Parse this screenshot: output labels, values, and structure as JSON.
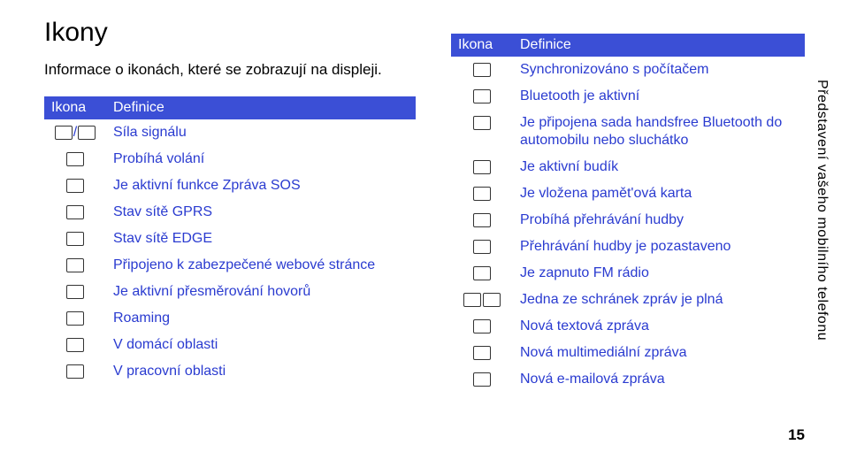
{
  "page": {
    "title": "Ikony",
    "subtitle": "Informace o ikonách, které se zobrazují na displeji.",
    "side_tab": "Představení vašeho mobilního telefonu",
    "page_number": "15"
  },
  "table_headers": {
    "icon": "Ikona",
    "def": "Definice"
  },
  "left_rows": [
    {
      "icon_name": "signal-bars-icon",
      "def": "Síla signálu"
    },
    {
      "icon_name": "call-icon",
      "def": "Probíhá volání"
    },
    {
      "icon_name": "sos-icon",
      "def": "Je aktivní funkce Zpráva SOS"
    },
    {
      "icon_name": "gprs-icon",
      "def": "Stav sítě GPRS"
    },
    {
      "icon_name": "edge-icon",
      "def": "Stav sítě EDGE"
    },
    {
      "icon_name": "secure-web-icon",
      "def": "Připojeno k zabezpečené webové stránce"
    },
    {
      "icon_name": "call-forward-icon",
      "def": "Je aktivní přesměrování hovorů"
    },
    {
      "icon_name": "roaming-icon",
      "def": "Roaming"
    },
    {
      "icon_name": "home-zone-icon",
      "def": "V domácí oblasti"
    },
    {
      "icon_name": "office-zone-icon",
      "def": "V pracovní oblasti"
    }
  ],
  "right_rows": [
    {
      "icon_name": "sync-icon",
      "def": "Synchronizováno s počítačem"
    },
    {
      "icon_name": "bluetooth-icon",
      "def": "Bluetooth je aktivní"
    },
    {
      "icon_name": "bt-handsfree-icon",
      "def": "Je připojena sada handsfree Bluetooth do automobilu nebo sluchátko"
    },
    {
      "icon_name": "alarm-icon",
      "def": "Je aktivní budík"
    },
    {
      "icon_name": "memory-card-icon",
      "def": "Je vložena pamět'ová karta"
    },
    {
      "icon_name": "music-play-icon",
      "def": "Probíhá přehrávání hudby"
    },
    {
      "icon_name": "music-pause-icon",
      "def": "Přehrávání hudby je pozastaveno"
    },
    {
      "icon_name": "fm-radio-icon",
      "def": "Je zapnuto FM rádio"
    },
    {
      "icon_name": "mailbox-full-icon",
      "def": "Jedna ze schránek zpráv je plná"
    },
    {
      "icon_name": "sms-icon",
      "def": "Nová textová zpráva"
    },
    {
      "icon_name": "mms-icon",
      "def": "Nová multimediální zpráva"
    },
    {
      "icon_name": "email-icon",
      "def": "Nová e-mailová zpráva"
    }
  ]
}
